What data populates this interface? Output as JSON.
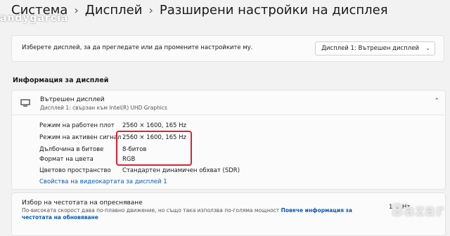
{
  "breadcrumb": {
    "item1": "Система",
    "item2": "Дисплей",
    "item3": "Разширени настройки на дисплея"
  },
  "watermark": "andygarcia",
  "select_display": {
    "label": "Изберете дисплей, за да прегледате или да промените настройките му.",
    "dropdown_value": "Дисплей 1: Вътрешен дисплей"
  },
  "info_section": {
    "title": "Информация за дисплей",
    "display_name": "Вътрешен дисплей",
    "display_sub": "Дисплей 1: свързан към Intel(R) UHD Graphics",
    "rows": [
      {
        "label": "Режим на работен плот",
        "value": "2560 × 1600, 165 Hz"
      },
      {
        "label": "Режим на активен сигнал",
        "value": "2560 × 1600, 165 Hz"
      },
      {
        "label": "Дълбочина в битове",
        "value": "8-битов"
      },
      {
        "label": "Формат на цвета",
        "value": "RGB"
      },
      {
        "label": "Цветово пространство",
        "value": "Стандартен динамичен обхват (SDR)"
      }
    ],
    "adapter_link": "Свойства на видеокартата за дисплей 1"
  },
  "refresh": {
    "title": "Избор на честотата на опресняване",
    "desc": "По-високата скорост дава по-плавно движение, но също така използва по-голяма мощност",
    "link": "Повече информация за честотата на обновяване",
    "value": "165 Hz"
  },
  "site_badge": "Bazar"
}
